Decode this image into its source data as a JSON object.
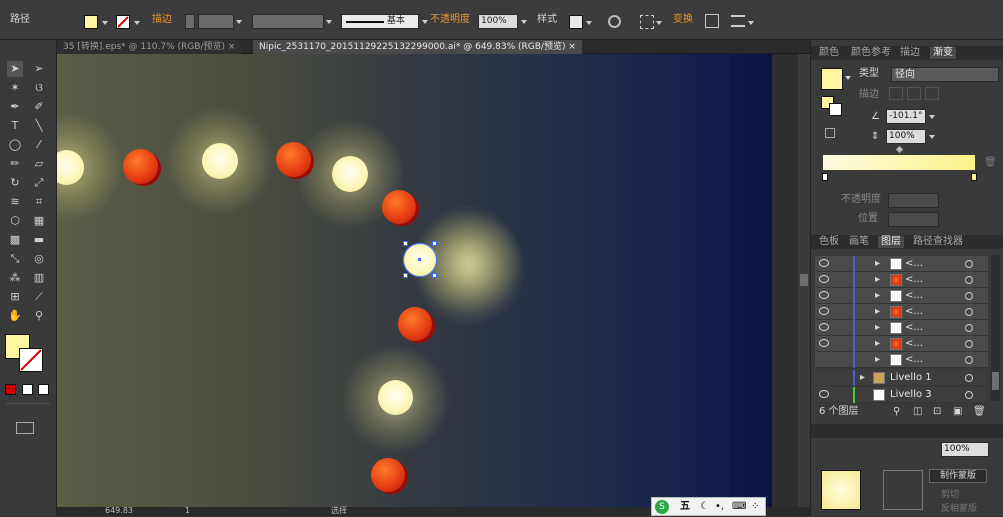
{
  "control_bar": {
    "path_label": "路径",
    "stroke_label": "描边",
    "stroke_style_label": "基本",
    "opacity_label": "不透明度",
    "opacity_value": "100%",
    "style_label": "样式",
    "transform_label": "变换"
  },
  "tabs": [
    {
      "label": "35 [转换].eps* @ 110.7% (RGB/预览)",
      "active": false
    },
    {
      "label": "Nipic_2531170_20151129225132299000.ai* @ 649.83% (RGB/预览)",
      "active": true
    }
  ],
  "status_bar": {
    "zoom": "649.83",
    "artboard": "1",
    "tool": "选择"
  },
  "gradient_panel": {
    "tabs": [
      "颜色",
      "颜色参考",
      "描边",
      "渐变"
    ],
    "type_label": "类型",
    "type_value": "径向",
    "stroke_label": "描边",
    "angle_value": "-101.1°",
    "aspect_value": "100%",
    "opacity_label": "不透明度",
    "position_label": "位置"
  },
  "layers_panel": {
    "tabs": [
      "色板",
      "画笔",
      "图层",
      "路径查找器"
    ],
    "rows": [
      {
        "name": "<...",
        "thumb": "yellow"
      },
      {
        "name": "<...",
        "thumb": "red"
      },
      {
        "name": "<...",
        "thumb": "yellow"
      },
      {
        "name": "<...",
        "thumb": "red"
      },
      {
        "name": "<...",
        "thumb": "yellow"
      },
      {
        "name": "<...",
        "thumb": "red"
      },
      {
        "name": "<...",
        "thumb": "yellow"
      }
    ],
    "layer_1": "Livello 1",
    "layer_3": "Livello 3",
    "count": "6 个图层"
  },
  "transparency_panel": {
    "opacity": "100%",
    "make_mask": "制作蒙版",
    "clip": "剪切",
    "invert": "反相蒙版"
  },
  "ime": {
    "label": "五"
  },
  "colors": {
    "accent_orange": "#e8952c",
    "fill_yellow": "#fdf5a0",
    "canvas_navy": "#0c1849"
  }
}
